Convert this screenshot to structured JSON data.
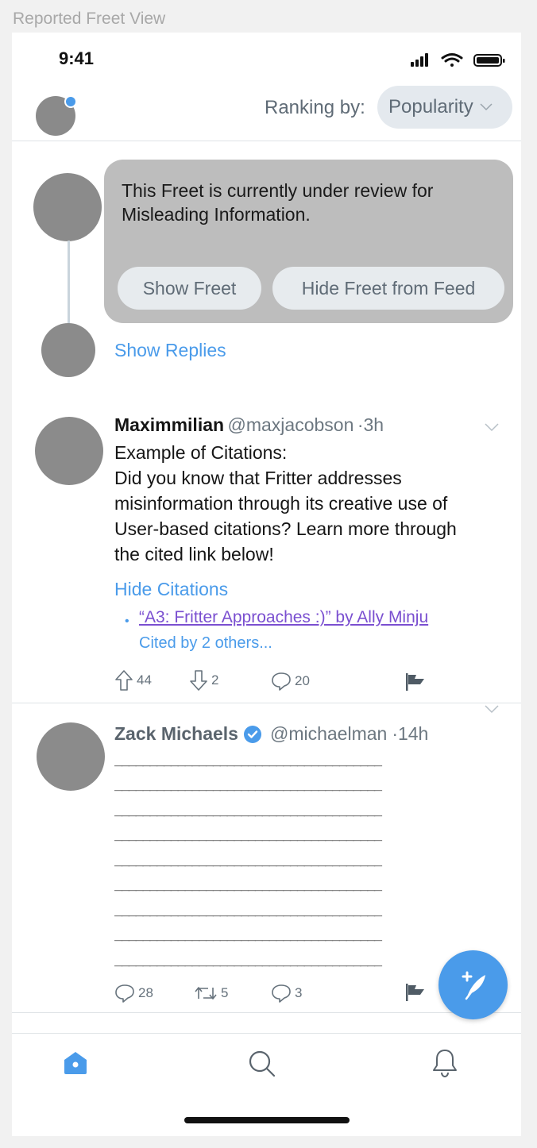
{
  "frame": {
    "label": "Reported Freet View"
  },
  "status_bar": {
    "time": "9:41"
  },
  "header": {
    "ranking_label": "Ranking by:",
    "ranking_value": "Popularity"
  },
  "reported_freet": {
    "notice": "This Freet is currently under review for Misleading Information.",
    "show_button": "Show Freet",
    "hide_button": "Hide Freet from Feed",
    "show_replies": "Show Replies"
  },
  "freets": [
    {
      "name": "Maximmilian",
      "handle": "@maxjacobson",
      "time": "·3h",
      "body_lines": [
        "Example of Citations:",
        "Did you know that Fritter addresses",
        "misinformation through its creative use of",
        "User-based citations? Learn more through",
        "the cited link below!"
      ],
      "hide_citations": "Hide Citations",
      "citation_bullet": "•",
      "citation": "“A3: Fritter Approaches :)” by Ally Minju",
      "cited_by": "Cited by 2 others...",
      "upvotes": "44",
      "downvotes": "2",
      "replies": "20"
    },
    {
      "name": "Zack Michaels",
      "handle": "@michaelman",
      "time": "·14h",
      "body_lines": [
        "______________________________________",
        "______________________________________",
        "______________________________________",
        "______________________________________",
        "______________________________________",
        "______________________________________",
        "______________________________________",
        "______________________________________",
        "______________________________________"
      ],
      "replies": "28",
      "refreets": "5",
      "comments": "3"
    }
  ],
  "colors": {
    "accent": "#4a9bea",
    "card": "#bdbdbd",
    "avatar": "#8b8b8b",
    "citation_link": "#7a4fd0"
  },
  "icons": {
    "upvote": "arrow-up-icon",
    "downvote": "arrow-down-icon",
    "reply": "speech-bubble-icon",
    "refreet": "retweet-icon",
    "flag": "flag-icon",
    "verified": "verified-badge-icon",
    "compose": "quill-plus-icon",
    "home": "home-icon",
    "search": "search-icon",
    "notifications": "bell-icon"
  }
}
